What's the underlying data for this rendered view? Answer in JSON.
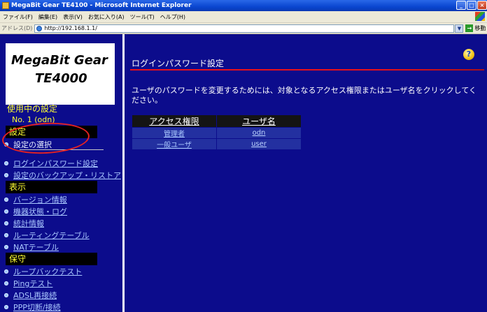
{
  "window": {
    "title": "MegaBit Gear TE4100 - Microsoft Internet Explorer",
    "buttons": [
      "_",
      "□",
      "×"
    ]
  },
  "menu": [
    "ファイル(F)",
    "編集(E)",
    "表示(V)",
    "お気に入り(A)",
    "ツール(T)",
    "ヘルプ(H)"
  ],
  "address": {
    "label": "アドレス(D)",
    "url": "http://192.168.1.1/",
    "go_label": "移動"
  },
  "sidebar": {
    "logo_line1": "MegaBit Gear",
    "logo_line2": "TE4000",
    "current_label": "使用中の設定",
    "current_value": "No. 1 (odn)",
    "sections": [
      {
        "heading": "設定",
        "items": [
          {
            "label": "設定の選択"
          },
          {
            "label": "ログインパスワード設定"
          },
          {
            "label": "設定のバックアップ・リストア"
          }
        ]
      },
      {
        "heading": "表示",
        "items": [
          {
            "label": "バージョン情報"
          },
          {
            "label": "機器状態・ログ"
          },
          {
            "label": "統計情報"
          },
          {
            "label": "ルーティングテーブル"
          },
          {
            "label": "NATテーブル"
          }
        ]
      },
      {
        "heading": "保守",
        "items": [
          {
            "label": "ループバックテスト"
          },
          {
            "label": "Pingテスト"
          },
          {
            "label": "ADSL再接続"
          },
          {
            "label": "PPP切断/接続"
          }
        ]
      }
    ]
  },
  "main": {
    "title": "ログインパスワード設定",
    "help_glyph": "?",
    "intro": "ユーザのパスワードを変更するためには、対象となるアクセス権限またはユーザ名をクリックしてください。",
    "table": {
      "headers": [
        "アクセス権限",
        "ユーザ名"
      ],
      "rows": [
        [
          "管理者",
          "odn"
        ],
        [
          "一般ユーザ",
          "user"
        ]
      ]
    }
  },
  "colors": {
    "background": "#0c0c8c",
    "highlight_text": "#ffff33",
    "link": "#aac8ff",
    "accent_rule": "#e8101a",
    "annotation": "#e52222"
  }
}
